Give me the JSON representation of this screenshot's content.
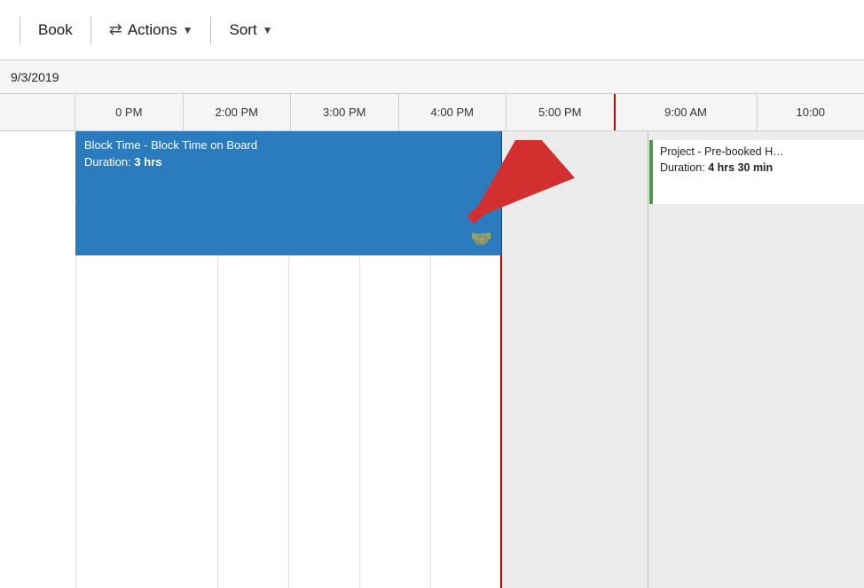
{
  "toolbar": {
    "separator1": "|",
    "book_label": "Book",
    "separator2": "|",
    "actions_label": "Actions",
    "separator3": "|",
    "sort_label": "Sort"
  },
  "calendar": {
    "date": "9/3/2019",
    "time_slots": [
      "0 PM",
      "2:00 PM",
      "3:00 PM",
      "4:00 PM",
      "5:00 PM",
      "9:00 AM",
      "10:00"
    ],
    "block_event": {
      "title": "Block Time - Block Time on Board",
      "duration_label": "Duration:",
      "duration_value": "3 hrs"
    },
    "project_event": {
      "title": "Project - Pre-booked H…",
      "duration_label": "Duration:",
      "duration_value": "4 hrs 30 min"
    }
  }
}
